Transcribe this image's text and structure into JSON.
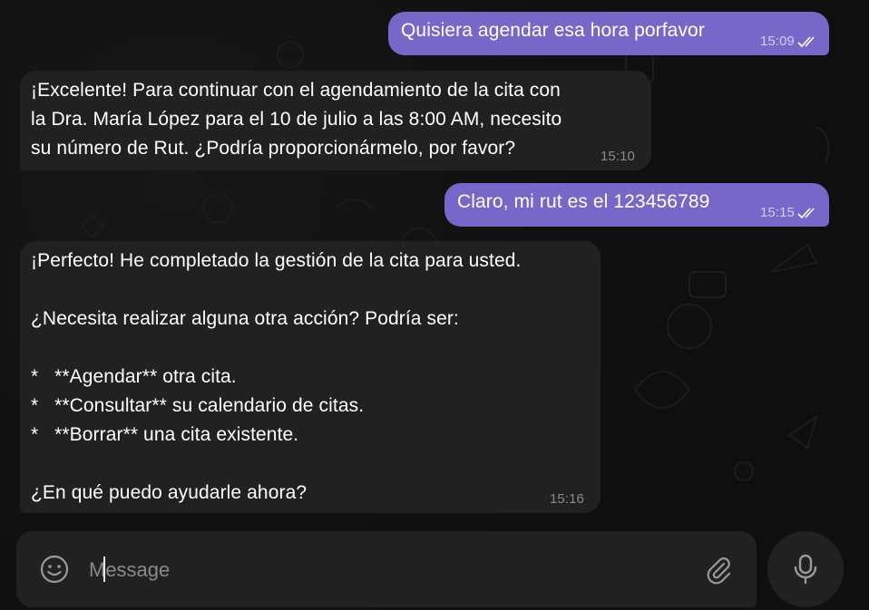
{
  "messages": [
    {
      "direction": "outgoing",
      "text": "Quisiera agendar esa hora porfavor",
      "time": "15:09",
      "status": "read"
    },
    {
      "direction": "incoming",
      "text": "¡Excelente! Para continuar con el agendamiento de la cita con\nla Dra. María López para el 10 de julio a las 8:00 AM, necesito\nsu número de Rut. ¿Podría proporcionármelo, por favor?",
      "time": "15:10"
    },
    {
      "direction": "outgoing",
      "text": "Claro, mi rut es el 123456789",
      "time": "15:15",
      "status": "read"
    },
    {
      "direction": "incoming",
      "text": "¡Perfecto! He completado la gestión de la cita para usted.\n\n¿Necesita realizar alguna otra acción? Podría ser:\n\n*   **Agendar** otra cita.\n*   **Consultar** su calendario de citas.\n*   **Borrar** una cita existente.\n\n¿En qué puedo ayudarle ahora?",
      "time": "15:16"
    }
  ],
  "composer": {
    "placeholder": "Message",
    "value": "",
    "icons": {
      "emoji": "smiley-icon",
      "attach": "paperclip-icon",
      "send": "microphone-icon"
    }
  },
  "colors": {
    "background": "#0f0f0f",
    "outgoing_bubble": "#7767c9",
    "incoming_bubble": "#212121",
    "text": "#ffffff",
    "time_incoming": "#8a8a8a",
    "time_outgoing": "#d5cdf7"
  }
}
